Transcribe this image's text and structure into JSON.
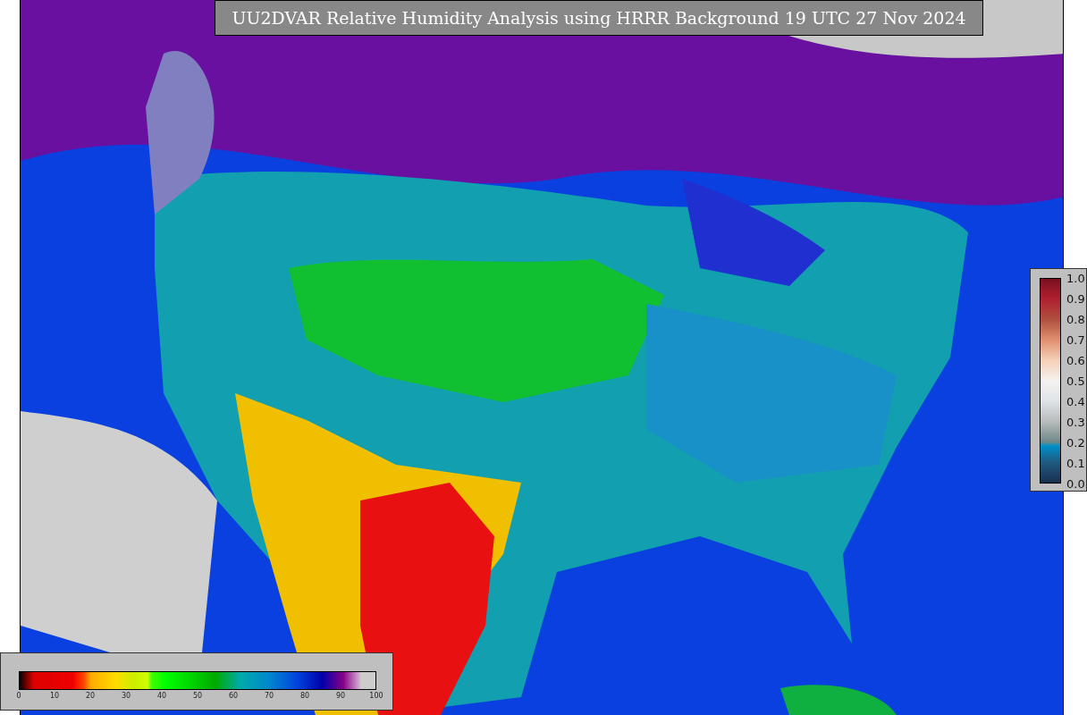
{
  "title": "UU2DVAR Relative Humidity Analysis using HRRR Background 19 UTC 27 Nov 2024",
  "humidity_colorbar": {
    "ticks": [
      "0",
      "10",
      "20",
      "30",
      "40",
      "50",
      "60",
      "70",
      "80",
      "90",
      "100"
    ]
  },
  "station_colorbar": {
    "ticks": [
      "1.0",
      "0.9",
      "0.8",
      "0.7",
      "0.6",
      "0.5",
      "0.4",
      "0.3",
      "0.2",
      "0.1",
      "0.0"
    ]
  }
}
